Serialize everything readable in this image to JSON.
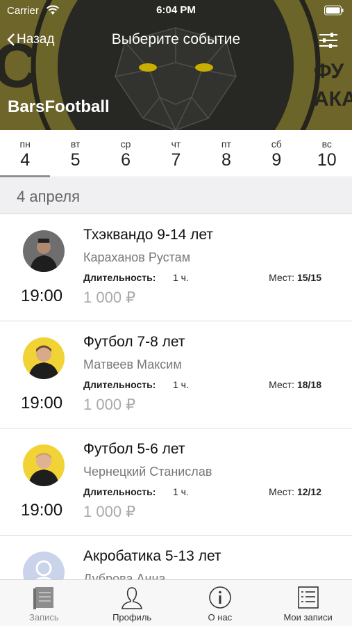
{
  "status_bar": {
    "carrier": "Carrier",
    "time": "6:04 PM"
  },
  "nav": {
    "back_label": "Назад",
    "title": "Выберите событие"
  },
  "club": {
    "name": "BarsFootball"
  },
  "days": [
    {
      "dow": "пн",
      "num": "4"
    },
    {
      "dow": "вт",
      "num": "5"
    },
    {
      "dow": "ср",
      "num": "6"
    },
    {
      "dow": "чт",
      "num": "7"
    },
    {
      "dow": "пт",
      "num": "8"
    },
    {
      "dow": "сб",
      "num": "9"
    },
    {
      "dow": "вс",
      "num": "10"
    }
  ],
  "selected_day": "4",
  "date_header": "4 апреля",
  "events": [
    {
      "title": "Тхэквандо 9-14 лет",
      "coach": "Караханов Рустам",
      "duration_label": "Длительность:",
      "duration": "1 ч.",
      "seats_label": "Мест:",
      "seats": "15/15",
      "time": "19:00",
      "price": "1 000 ₽"
    },
    {
      "title": "Футбол 7-8 лет",
      "coach": "Матвеев Максим",
      "duration_label": "Длительность:",
      "duration": "1 ч.",
      "seats_label": "Мест:",
      "seats": "18/18",
      "time": "19:00",
      "price": "1 000 ₽"
    },
    {
      "title": "Футбол 5-6 лет",
      "coach": "Чернецкий Станислав",
      "duration_label": "Длительность:",
      "duration": "1 ч.",
      "seats_label": "Мест:",
      "seats": "12/12",
      "time": "19:00",
      "price": "1 000 ₽"
    },
    {
      "title": "Акробатика 5-13 лет",
      "coach": "Дуброва Анна"
    }
  ],
  "tabs": [
    {
      "label": "Запись",
      "icon": "book-icon"
    },
    {
      "label": "Профиль",
      "icon": "profile-icon"
    },
    {
      "label": "О нас",
      "icon": "info-icon"
    },
    {
      "label": "Мои записи",
      "icon": "list-icon"
    }
  ],
  "banner_text": {
    "left": "С",
    "right_top": "ФУ",
    "right_bottom": "АКА"
  },
  "colors": {
    "banner": "#7d7431",
    "eye": "#e3c600",
    "avatar_yellow": "#f2d336",
    "avatar_blue": "#c9d3ea"
  }
}
